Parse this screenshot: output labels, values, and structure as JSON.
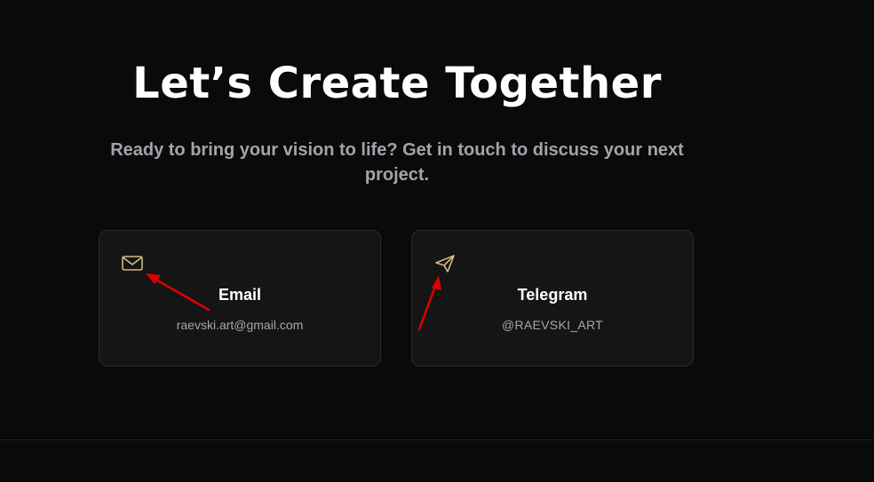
{
  "hero": {
    "title": "Let’s Create Together",
    "subtitle": "Ready to bring your vision to life? Get in touch to discuss your next project."
  },
  "contacts": [
    {
      "icon": "mail-icon",
      "title": "Email",
      "value": "raevski.art@gmail.com"
    },
    {
      "icon": "send-icon",
      "title": "Telegram",
      "value": "@RAEVSKI_ART"
    }
  ],
  "colors": {
    "background": "#0a0a0a",
    "card_background": "#151515",
    "card_border": "#2a2a2a",
    "icon_accent": "#d8b98a",
    "annotation_arrow": "#e00000",
    "subtitle_text": "#a3a3ab"
  }
}
